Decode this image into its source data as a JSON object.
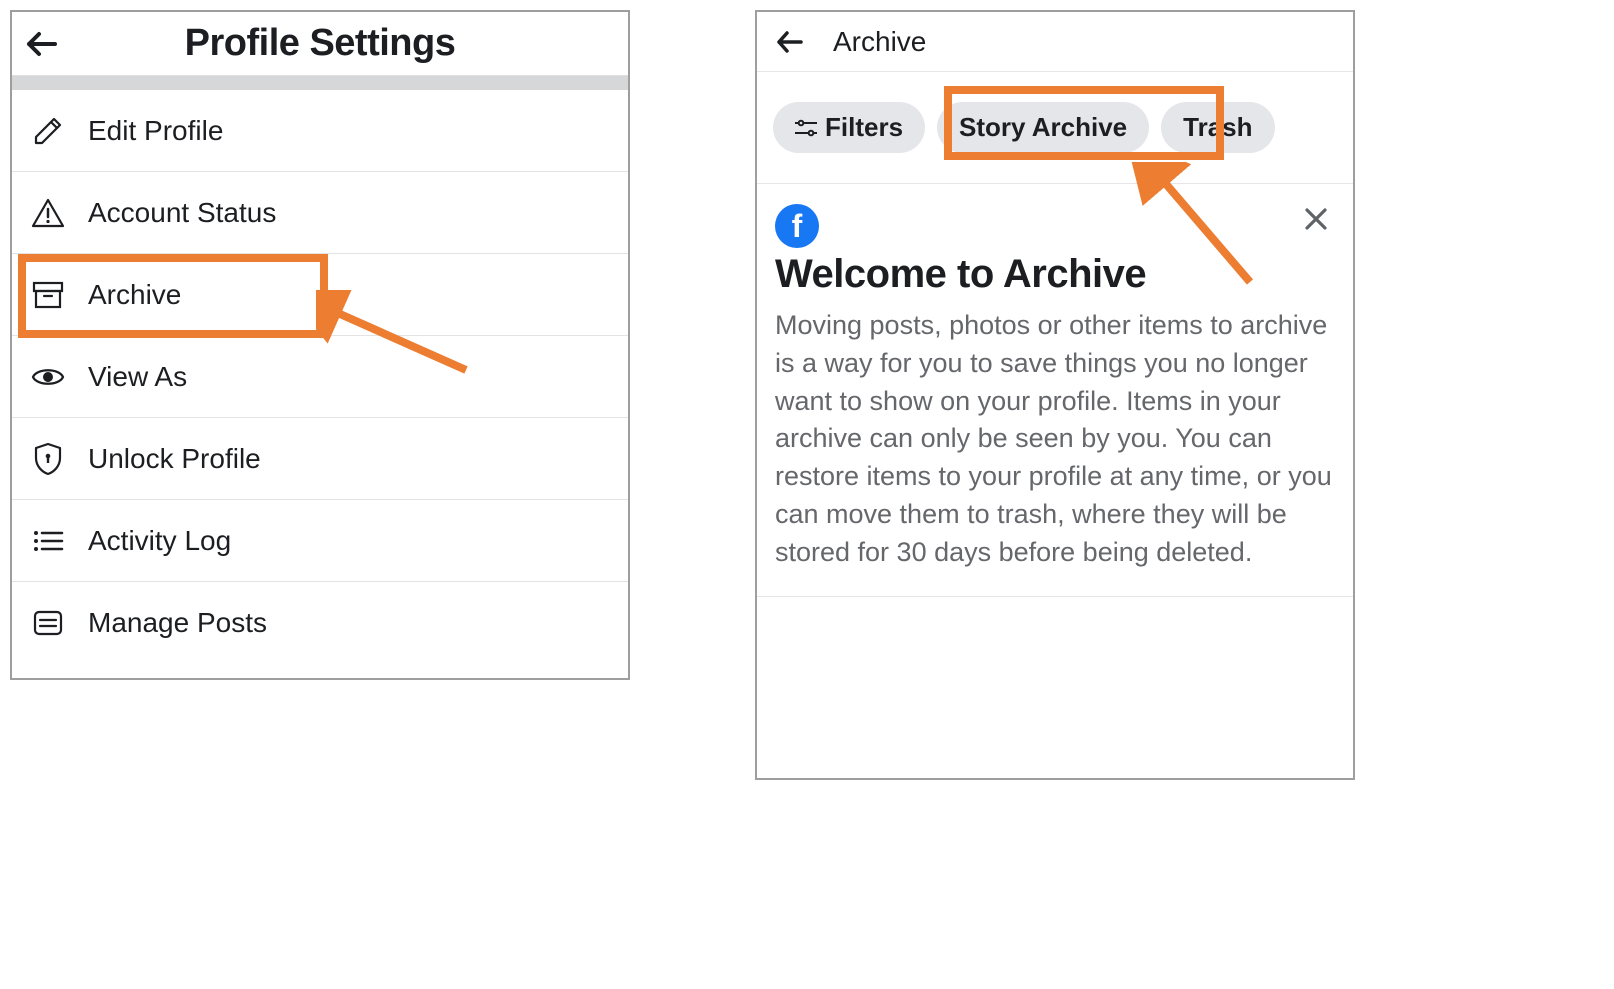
{
  "left": {
    "title": "Profile Settings",
    "items": [
      {
        "label": "Edit Profile",
        "icon": "pencil-icon"
      },
      {
        "label": "Account Status",
        "icon": "warning-triangle-icon"
      },
      {
        "label": "Archive",
        "icon": "archive-box-icon",
        "highlighted": true
      },
      {
        "label": "View As",
        "icon": "eye-icon"
      },
      {
        "label": "Unlock Profile",
        "icon": "shield-lock-icon"
      },
      {
        "label": "Activity Log",
        "icon": "list-bullets-icon"
      },
      {
        "label": "Manage Posts",
        "icon": "document-lines-icon"
      }
    ]
  },
  "right": {
    "title": "Archive",
    "chips": {
      "filters": "Filters",
      "story_archive": "Story Archive",
      "trash": "Trash"
    },
    "welcome": {
      "heading": "Welcome to Archive",
      "body": "Moving posts, photos or other items to archive is a way for you to save things you no longer want to show on your profile. Items in your archive can only be seen by you. You can restore items to your profile at any time, or you can move them to trash, where they will be stored for 30 days before being deleted."
    }
  },
  "annotations": {
    "highlight_color": "#ed7d31"
  }
}
